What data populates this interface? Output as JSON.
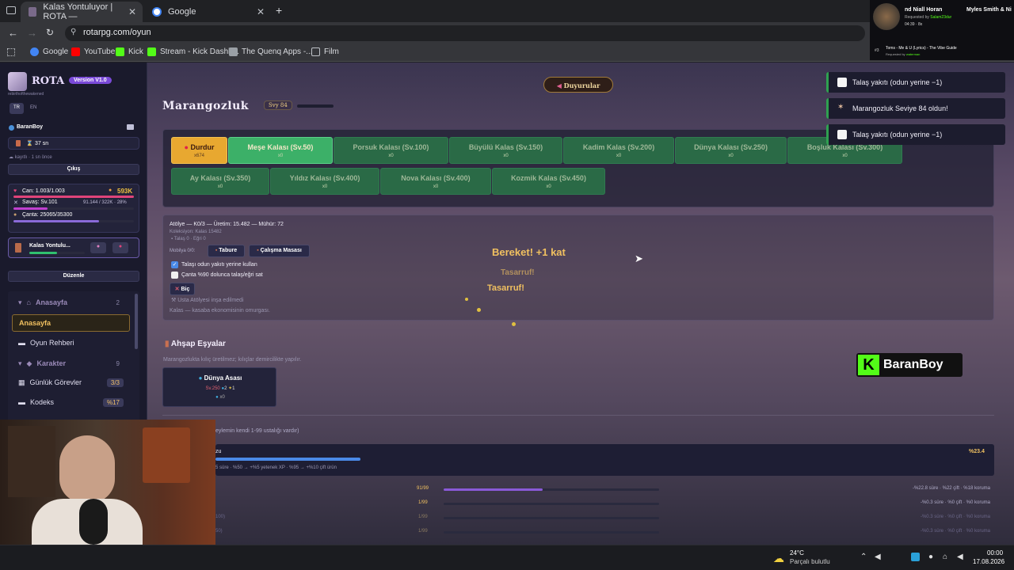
{
  "browser": {
    "tabs": [
      {
        "title": "Kalas Yontuluyor | ROTA —",
        "active": true
      },
      {
        "title": "Google",
        "active": false
      }
    ],
    "new_tab": "+",
    "url": "rotarpg.com/oyun",
    "bookmarks": [
      "Google",
      "YouTube",
      "Kick",
      "Stream - Kick Dashb...",
      "The Quenq Apps -...",
      "Film"
    ]
  },
  "overlay": {
    "music_now": "nd Niall Horan",
    "music_artist": "Myles Smith & Ni",
    "music_req": "Requested by",
    "music_req_user": "Salam23dur",
    "music_time": "04:39",
    "music_count": "8x",
    "queue_num": "#3",
    "queue_title": "Toms - Me & U (Lyrics) - The Vibe Guide",
    "queue_req": "Requested by",
    "queue_user": "waterman",
    "kick_user": "BaranBoy"
  },
  "sidebar": {
    "brand": "ROTA",
    "version": "Version V1.0",
    "tagline": "rebirthofthewakened",
    "lang_tr": "TR",
    "lang_en": "EN",
    "username": "BaranBoy",
    "timer": "37 sn",
    "saved": "kayıtlı · 1 sn önce",
    "logout": "Çıkış",
    "hp_label": "Can: 1.003/1.003",
    "gold": "593K",
    "war_label": "Savaş: Sv.101",
    "war_xp": "91.144 / 322K · 28%",
    "bag_label": "Çanta: 25065/35300",
    "activity": "Kalas Yontulu...",
    "edit": "Düzenle",
    "nav": [
      {
        "label": "Anasayfa",
        "type": "section",
        "count": "2"
      },
      {
        "label": "Anasayfa",
        "type": "active"
      },
      {
        "label": "Oyun Rehberi",
        "type": "item"
      },
      {
        "label": "Karakter",
        "type": "section",
        "count": "9"
      },
      {
        "label": "Günlük Görevler",
        "type": "item",
        "badge": "3/3"
      },
      {
        "label": "Kodeks",
        "type": "item",
        "badge": "%17"
      }
    ]
  },
  "main": {
    "announce": "Duyurular",
    "title": "Marangozluk",
    "level": "Svy 84",
    "stop_label": "Durdur",
    "stop_sub": "x674",
    "buttons": [
      {
        "label": "Meşe Kalası (Sv.50)",
        "sub": "x0"
      },
      {
        "label": "Porsuk Kalası (Sv.100)",
        "sub": "x0"
      },
      {
        "label": "Büyülü Kalas (Sv.150)",
        "sub": "x0"
      },
      {
        "label": "Kadim Kalas (Sv.200)",
        "sub": "x0"
      },
      {
        "label": "Dünya Kalası (Sv.250)",
        "sub": "x0"
      },
      {
        "label": "Boşluk Kalası (Sv.300)",
        "sub": "x0"
      },
      {
        "label": "Ay Kalası (Sv.350)",
        "sub": "x0"
      },
      {
        "label": "Yıldız Kalası (Sv.400)",
        "sub": "x0"
      },
      {
        "label": "Nova Kalası (Sv.400)",
        "sub": "x0"
      },
      {
        "label": "Kozmik Kalas (Sv.450)",
        "sub": "x0"
      }
    ],
    "workshop": "Atölye — K0/3 — Üretim: 15.482 — Mühür: 72",
    "collection": "Koleksiyon: Kalas 15482",
    "tal_egri": "Talaş 0 · Eğri 0",
    "furniture": "Mobilya 0/0:",
    "stool": "Tabure",
    "workbench": "Çalışma Masası",
    "check1": "Talaşı odun yakıtı yerine kullan",
    "check2": "Çanta %90 dolunca talaş/eğri sat",
    "cut": "Biç",
    "master": "Usta Atölyesi inşa edilmedi",
    "footnote": "Kalas — kasaba ekonomisinin omurgası.",
    "float_bonus": "Bereket! +1 kat",
    "float_save1": "Tasarruf!",
    "float_save2": "Tasarruf!",
    "wood_title": "Ahşap Eşyalar",
    "wood_desc": "Marangozlukta kılıç üretilmez; kılıçlar demircilikte yapılır.",
    "item_name": "Dünya Asası",
    "item_lv": "Sv.250",
    "item_a": "2",
    "item_b": "1",
    "item_count": "x0",
    "mastery_note": "eylemin kendi 1-99 ustalığı vardır)",
    "mastery_head": "zu",
    "mastery_pct": "%23.4",
    "mastery_desc": "5 süre · %50 → +%5 yetenek XP · %95 → +%10 çift ürün",
    "rows": [
      {
        "label": "",
        "level": "91/99",
        "fill": 0.46,
        "bonus": "-%22.8 süre · %22 çift · %18 koruma"
      },
      {
        "label": "",
        "level": "1/99",
        "fill": 0,
        "bonus": "-%0.3 süre · %0 çift · %0 koruma"
      },
      {
        "label": "100)",
        "level": "1/99",
        "fill": 0,
        "bonus": "-%0.3 süre · %0 çift · %0 koruma"
      },
      {
        "label": "50)",
        "level": "1/99",
        "fill": 0,
        "bonus": "-%0.3 süre · %0 çift · %0 koruma"
      }
    ]
  },
  "toasts": [
    "Talaş yakıtı (odun yerine −1)",
    "Marangozluk Seviye 84 oldun!",
    "Talaş yakıtı (odun yerine −1)"
  ],
  "taskbar": {
    "temp": "24°C",
    "weather": "Parçalı bulutlu",
    "time": "00:00",
    "date": "17.08.2026"
  }
}
